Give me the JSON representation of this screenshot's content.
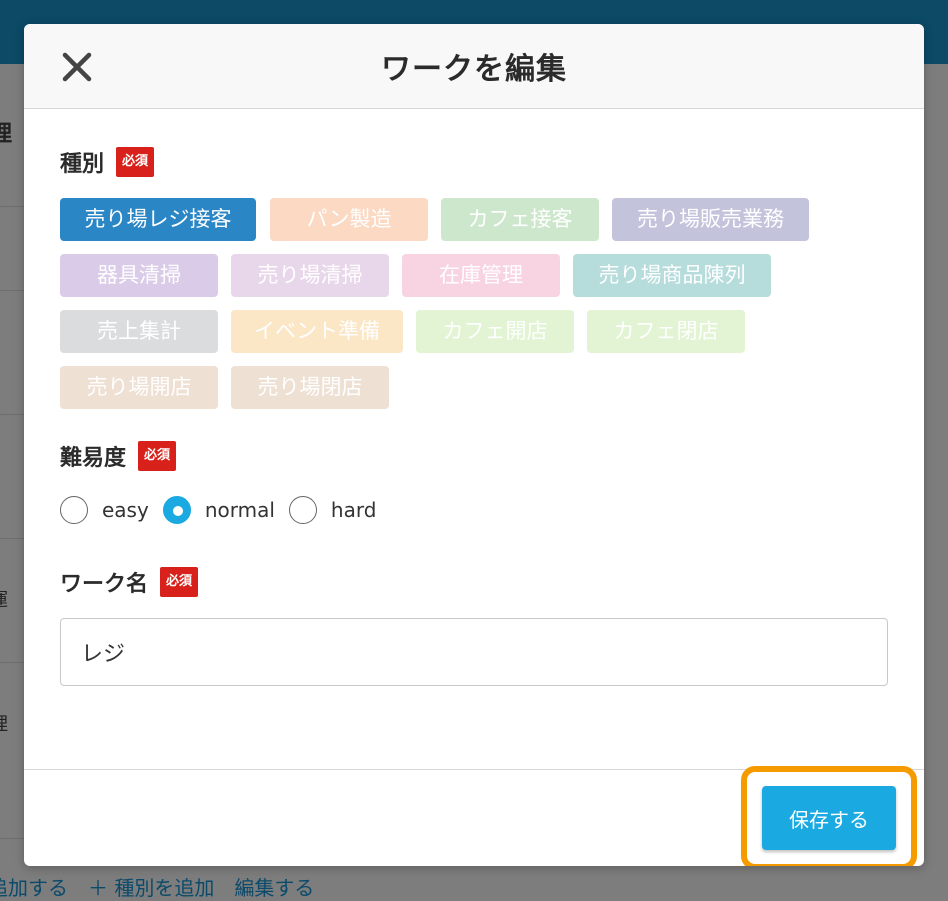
{
  "background": {
    "fragments": [
      "理",
      "運",
      "理"
    ],
    "bottom_links": "追加する　＋ 種別を追加　編集する"
  },
  "modal": {
    "title": "ワークを編集",
    "close_icon": "close-icon",
    "category": {
      "label": "種別",
      "required": "必須",
      "chips": [
        {
          "label": "売り場レジ接客",
          "color": "#2b86c5",
          "selected": true
        },
        {
          "label": "パン製造",
          "color": "#fbd9c3",
          "selected": false
        },
        {
          "label": "カフェ接客",
          "color": "#cde7cd",
          "selected": false
        },
        {
          "label": "売り場販売業務",
          "color": "#c3c3dc",
          "selected": false
        },
        {
          "label": "器具清掃",
          "color": "#dacce8",
          "selected": false
        },
        {
          "label": "売り場清掃",
          "color": "#e8d6ea",
          "selected": false
        },
        {
          "label": "在庫管理",
          "color": "#f8d4e3",
          "selected": false
        },
        {
          "label": "売り場商品陳列",
          "color": "#b7dcdc",
          "selected": false
        },
        {
          "label": "売上集計",
          "color": "#dadcde",
          "selected": false
        },
        {
          "label": "イベント準備",
          "color": "#fbe6c6",
          "selected": false
        },
        {
          "label": "カフェ開店",
          "color": "#e2f4d3",
          "selected": false
        },
        {
          "label": "カフェ閉店",
          "color": "#e2f4d3",
          "selected": false
        },
        {
          "label": "売り場開店",
          "color": "#efe0d4",
          "selected": false
        },
        {
          "label": "売り場閉店",
          "color": "#efe0d4",
          "selected": false
        }
      ]
    },
    "difficulty": {
      "label": "難易度",
      "required": "必須",
      "options": [
        "easy",
        "normal",
        "hard"
      ],
      "selected": "normal"
    },
    "work_name": {
      "label": "ワーク名",
      "required": "必須",
      "value": "レジ"
    },
    "save_label": "保存する"
  }
}
